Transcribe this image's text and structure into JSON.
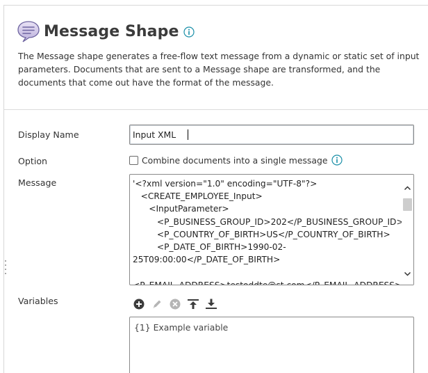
{
  "shape": {
    "title": "Message Shape",
    "icon": "speech-bubble-icon",
    "description": "The Message shape generates a free-flow text message from a dynamic or static set of input parameters. Documents that are sent to a Message shape are transformed, and the documents that come out have the format of the message."
  },
  "form": {
    "display_name_label": "Display Name",
    "display_name_value": "Input XML",
    "option_label": "Option",
    "combine_label": "Combine documents into a single message",
    "combine_checked": false,
    "message_label": "Message",
    "message_value": "'<?xml version=\"1.0\" encoding=\"UTF-8\"?>\n   <CREATE_EMPLOYEE_Input>\n      <InputParameter>\n         <P_BUSINESS_GROUP_ID>202</P_BUSINESS_GROUP_ID>\n         <P_COUNTRY_OF_BIRTH>US</P_COUNTRY_OF_BIRTH>\n         <P_DATE_OF_BIRTH>1990-02-\n25T09:00:00</P_DATE_OF_BIRTH>\n\n<P_EMAIL_ADDRESS>testoddte@st.com</P_EMAIL_ADDRESS>",
    "variables_label": "Variables",
    "variables": [
      "{1} Example variable"
    ]
  },
  "toolbar": {
    "add_icon": "plus-circle-icon",
    "edit_icon": "pencil-icon",
    "remove_icon": "x-circle-icon",
    "move_up_icon": "move-to-top-icon",
    "move_down_icon": "move-to-bottom-icon"
  },
  "colors": {
    "accent": "#1a8fa8",
    "icon_dark": "#3c3c3c",
    "icon_disabled": "#b5b5b5",
    "border": "#8a8a8a"
  }
}
